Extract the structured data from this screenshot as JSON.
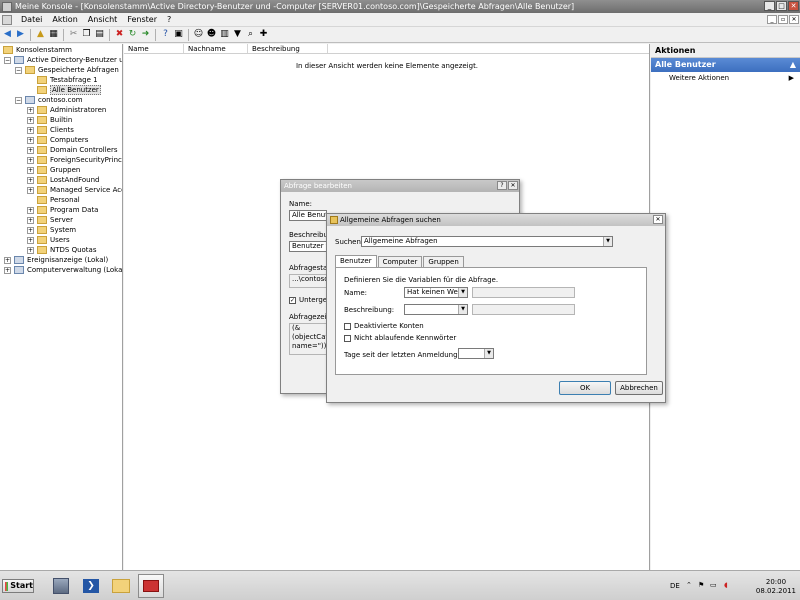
{
  "window": {
    "title": "Meine Konsole - [Konsolenstamm\\Active Directory-Benutzer und -Computer [SERVER01.contoso.com]\\Gespeicherte Abfragen\\Alle Benutzer]"
  },
  "menu": [
    "Datei",
    "Aktion",
    "Ansicht",
    "Fenster",
    "?"
  ],
  "tree": {
    "items": [
      {
        "label": "Konsolenstamm"
      },
      {
        "label": "Active Directory-Benutzer und"
      },
      {
        "label": "Gespeicherte Abfragen"
      },
      {
        "label": "Testabfrage 1"
      },
      {
        "label": "Alle Benutzer"
      },
      {
        "label": "contoso.com"
      },
      {
        "label": "Administratoren"
      },
      {
        "label": "Builtin"
      },
      {
        "label": "Clients"
      },
      {
        "label": "Computers"
      },
      {
        "label": "Domain Controllers"
      },
      {
        "label": "ForeignSecurityPrincipa"
      },
      {
        "label": "Gruppen"
      },
      {
        "label": "LostAndFound"
      },
      {
        "label": "Managed Service Accou"
      },
      {
        "label": "Personal"
      },
      {
        "label": "Program Data"
      },
      {
        "label": "Server"
      },
      {
        "label": "System"
      },
      {
        "label": "Users"
      },
      {
        "label": "NTDS Quotas"
      },
      {
        "label": "Ereignisanzeige (Lokal)"
      },
      {
        "label": "Computerverwaltung (Lokal)"
      }
    ]
  },
  "list": {
    "columns": [
      "Name",
      "Nachname",
      "Beschreibung"
    ],
    "empty_text": "In dieser Ansicht werden keine Elemente angezeigt."
  },
  "actions": {
    "header": "Aktionen",
    "section": "Alle Benutzer",
    "item": "Weitere Aktionen"
  },
  "edit_dialog": {
    "title": "Abfrage bearbeiten",
    "name_label": "Name:",
    "name_value": "Alle Benutze",
    "desc_label": "Beschreibun",
    "desc_value": "Benutzer fu",
    "root_label": "Abfragestam",
    "root_value": "...\\contoso",
    "sub_label": "Untergeo",
    "string_label": "Abfragezeic",
    "string_value": "(&(objectCat name=\"))"
  },
  "find_dialog": {
    "title": "Allgemeine Abfragen suchen",
    "search_label": "Suchen:",
    "search_value": "Allgemeine Abfragen",
    "tabs": [
      "Benutzer",
      "Computer",
      "Gruppen"
    ],
    "define_text": "Definieren Sie die Variablen für die Abfrage.",
    "name_label": "Name:",
    "name_mode": "Hat keinen Wert",
    "desc_label": "Beschreibung:",
    "disabled_accounts": "Deaktivierte Konten",
    "no_expire": "Nicht ablaufende Kennwörter",
    "days_label": "Tage seit der letzten Anmeldung:",
    "ok": "OK",
    "cancel": "Abbrechen"
  },
  "taskbar": {
    "start": "Start",
    "lang": "DE",
    "time": "20:00",
    "date": "08.02.2011"
  }
}
